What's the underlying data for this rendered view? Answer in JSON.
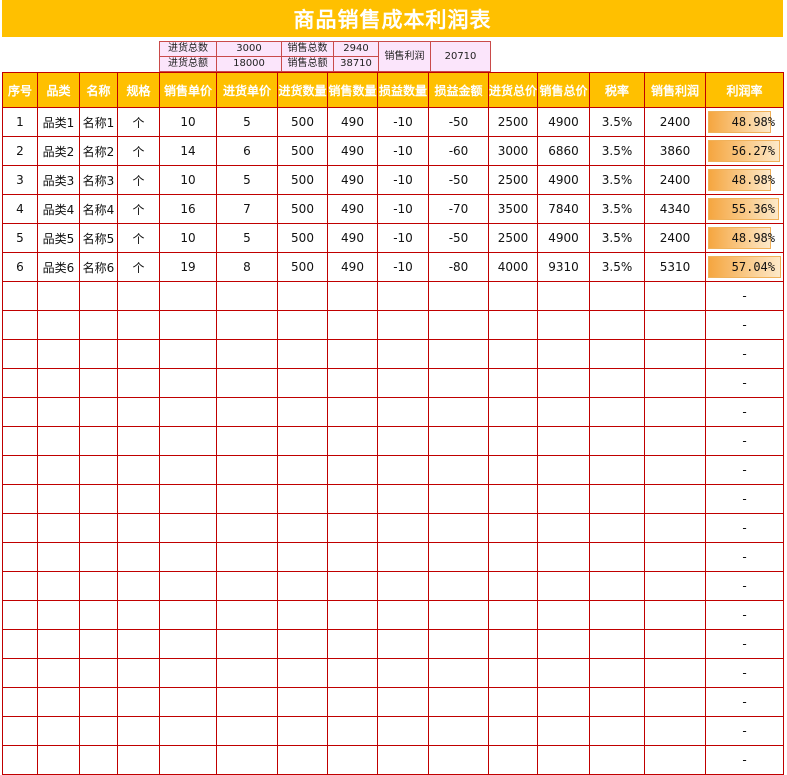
{
  "title": "商品销售成本利润表",
  "summary": {
    "purchase_qty_label": "进货总数",
    "purchase_qty": "3000",
    "sales_qty_label": "销售总数",
    "sales_qty": "2940",
    "profit_label": "销售利润",
    "profit": "20710",
    "purchase_amt_label": "进货总额",
    "purchase_amt": "18000",
    "sales_amt_label": "销售总额",
    "sales_amt": "38710"
  },
  "headers": [
    "序号",
    "品类",
    "名称",
    "规格",
    "销售单价",
    "进货单价",
    "进货数量",
    "销售数量",
    "损益数量",
    "损益金额",
    "进货总价",
    "销售总价",
    "税率",
    "销售利润",
    "利润率"
  ],
  "rows": [
    {
      "cells": [
        "1",
        "品类1",
        "名称1",
        "个",
        "10",
        "5",
        "500",
        "490",
        "-10",
        "-50",
        "2500",
        "4900",
        "3.5%",
        "2400"
      ],
      "rate": "48.98%",
      "rate_value": 0.4898
    },
    {
      "cells": [
        "2",
        "品类2",
        "名称2",
        "个",
        "14",
        "6",
        "500",
        "490",
        "-10",
        "-60",
        "3000",
        "6860",
        "3.5%",
        "3860"
      ],
      "rate": "56.27%",
      "rate_value": 0.5627
    },
    {
      "cells": [
        "3",
        "品类3",
        "名称3",
        "个",
        "10",
        "5",
        "500",
        "490",
        "-10",
        "-50",
        "2500",
        "4900",
        "3.5%",
        "2400"
      ],
      "rate": "48.98%",
      "rate_value": 0.4898
    },
    {
      "cells": [
        "4",
        "品类4",
        "名称4",
        "个",
        "16",
        "7",
        "500",
        "490",
        "-10",
        "-70",
        "3500",
        "7840",
        "3.5%",
        "4340"
      ],
      "rate": "55.36%",
      "rate_value": 0.5536
    },
    {
      "cells": [
        "5",
        "品类5",
        "名称5",
        "个",
        "10",
        "5",
        "500",
        "490",
        "-10",
        "-50",
        "2500",
        "4900",
        "3.5%",
        "2400"
      ],
      "rate": "48.98%",
      "rate_value": 0.4898
    },
    {
      "cells": [
        "6",
        "品类6",
        "名称6",
        "个",
        "19",
        "8",
        "500",
        "490",
        "-10",
        "-80",
        "4000",
        "9310",
        "3.5%",
        "5310"
      ],
      "rate": "57.04%",
      "rate_value": 0.5704
    }
  ],
  "empty_rate": "-",
  "empty_row_count": 17
}
